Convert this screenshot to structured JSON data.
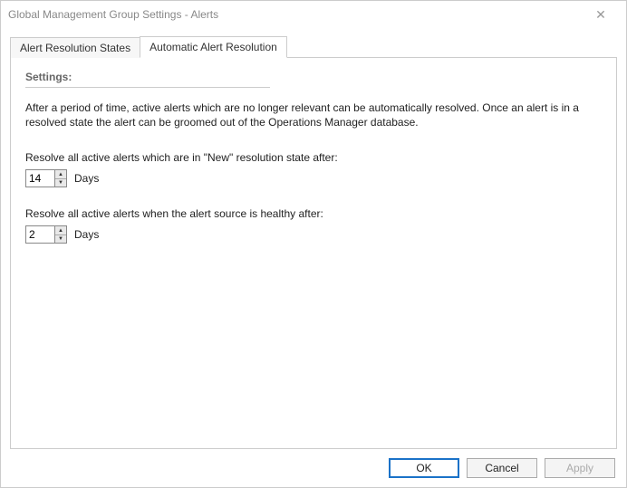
{
  "window": {
    "title": "Global Management Group Settings - Alerts",
    "close_glyph": "✕"
  },
  "tabs": {
    "alert_resolution_states": "Alert Resolution States",
    "automatic_alert_resolution": "Automatic Alert Resolution"
  },
  "panel": {
    "heading": "Settings:",
    "description": "After a period of time, active alerts which are no longer relevant can be automatically resolved. Once an alert is in a resolved state the alert can be groomed out of the Operations Manager database.",
    "field1": {
      "label": "Resolve all active alerts which are in \"New\" resolution state after:",
      "value": "14",
      "unit": "Days"
    },
    "field2": {
      "label": "Resolve all active alerts when the alert source is healthy after:",
      "value": "2",
      "unit": "Days"
    }
  },
  "buttons": {
    "ok": "OK",
    "cancel": "Cancel",
    "apply": "Apply"
  }
}
